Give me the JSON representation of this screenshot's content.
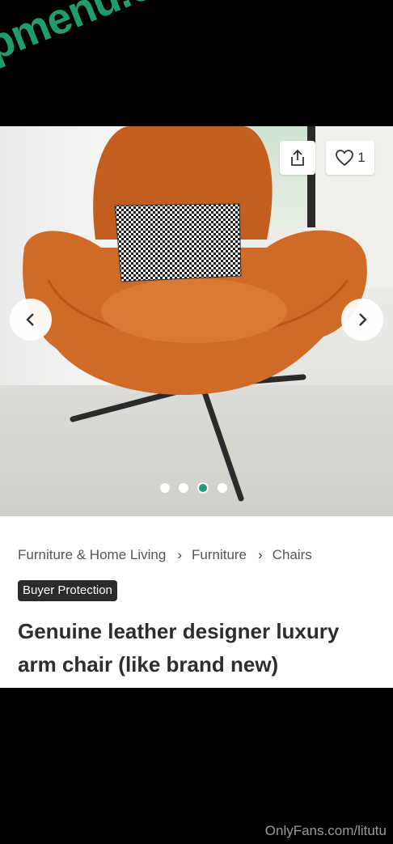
{
  "watermark": {
    "text": "fapmenu.com",
    "color": "#1f9d6a"
  },
  "listing": {
    "like_count": "1",
    "carousel": {
      "total": 4,
      "active_index": 2
    },
    "breadcrumb": [
      "Furniture & Home Living",
      "Furniture",
      "Chairs"
    ],
    "badge": "Buyer Protection",
    "title": "Genuine leather designer luxury arm chair (like brand new)"
  },
  "footer": {
    "watermark": "OnlyFans.com/litutu"
  },
  "colors": {
    "accent": "#1e9a7a",
    "badge_bg": "#2b2b2b"
  },
  "icons": [
    "share-icon",
    "heart-icon",
    "chevron-left-icon",
    "chevron-right-icon",
    "chevron-right-small-icon"
  ]
}
